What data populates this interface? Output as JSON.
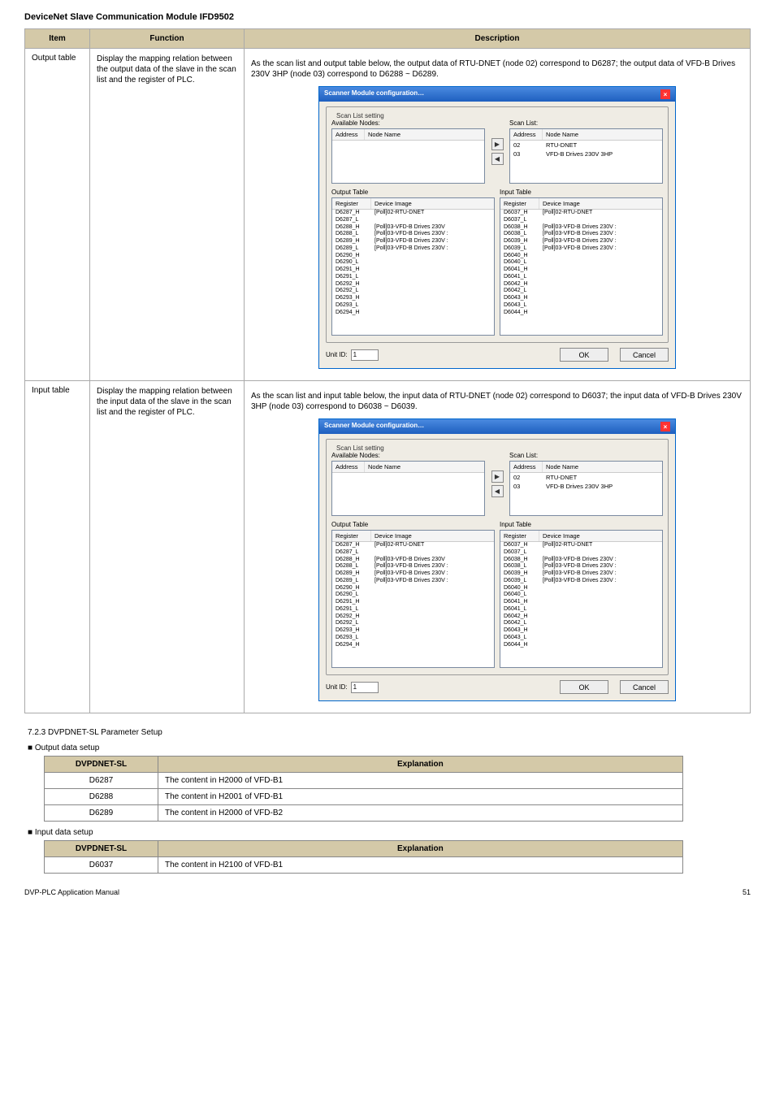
{
  "page_header": "DeviceNet Slave Communication Module IFD9502",
  "doc_title": "DeviceNet Slave Communication Module IFD9502",
  "main_table": {
    "hdr_item": "Item",
    "hdr_func": "Function",
    "hdr_desc": "Description",
    "rows": [
      {
        "item": "Output table",
        "func": "Display the mapping relation between the output data of the slave in the scan list and the register of PLC.",
        "pre": "As the scan list and output table below, the output data of RTU-DNET (node 02) correspond to D6287; the output data of VFD-B Drives 230V 3HP (node 03) correspond to D6288 ~ D6289.",
        "scan": [
          {
            "a": "02",
            "n": "RTU-DNET"
          },
          {
            "a": "03",
            "n": "VFD-B Drives 230V 3HP"
          }
        ],
        "output": [
          {
            "r": "D6287_H",
            "d": "[Poll]02-RTU-DNET"
          },
          {
            "r": "D6287_L",
            "d": ""
          },
          {
            "r": "D6288_H",
            "d": "[Poll]03-VFD-B Drives 230V"
          },
          {
            "r": "D6288_L",
            "d": "[Poll]03-VFD-B Drives 230V :"
          },
          {
            "r": "D6289_H",
            "d": "[Poll]03-VFD-B Drives 230V :"
          },
          {
            "r": "D6289_L",
            "d": "[Poll]03-VFD-B Drives 230V :"
          },
          {
            "r": "D6290_H",
            "d": ""
          },
          {
            "r": "D6290_L",
            "d": ""
          },
          {
            "r": "D6291_H",
            "d": ""
          },
          {
            "r": "D6291_L",
            "d": ""
          },
          {
            "r": "D6292_H",
            "d": ""
          },
          {
            "r": "D6292_L",
            "d": ""
          },
          {
            "r": "D6293_H",
            "d": ""
          },
          {
            "r": "D6293_L",
            "d": ""
          },
          {
            "r": "D6294_H",
            "d": ""
          }
        ],
        "input": [
          {
            "r": "D6037_H",
            "d": "[Poll]02-RTU-DNET"
          },
          {
            "r": "D6037_L",
            "d": ""
          },
          {
            "r": "D6038_H",
            "d": "[Poll]03-VFD-B Drives 230V :"
          },
          {
            "r": "D6038_L",
            "d": "[Poll]03-VFD-B Drives 230V :"
          },
          {
            "r": "D6039_H",
            "d": "[Poll]03-VFD-B Drives 230V :"
          },
          {
            "r": "D6039_L",
            "d": "[Poll]03-VFD-B Drives 230V :"
          },
          {
            "r": "D6040_H",
            "d": ""
          },
          {
            "r": "D6040_L",
            "d": ""
          },
          {
            "r": "D6041_H",
            "d": ""
          },
          {
            "r": "D6041_L",
            "d": ""
          },
          {
            "r": "D6042_H",
            "d": ""
          },
          {
            "r": "D6042_L",
            "d": ""
          },
          {
            "r": "D6043_H",
            "d": ""
          },
          {
            "r": "D6043_L",
            "d": ""
          },
          {
            "r": "D6044_H",
            "d": ""
          }
        ]
      },
      {
        "item": "Input table",
        "func": "Display the mapping relation between the input data of the slave in the scan list and the register of PLC.",
        "pre": "As the scan list and input table below, the input data of RTU-DNET (node 02) correspond to D6037; the input data of VFD-B Drives 230V 3HP (node 03) correspond to D6038 ~ D6039.",
        "scan": [
          {
            "a": "02",
            "n": "RTU-DNET"
          },
          {
            "a": "03",
            "n": "VFD-B Drives 230V 3HP"
          }
        ],
        "output": [
          {
            "r": "D6287_H",
            "d": "[Poll]02-RTU-DNET"
          },
          {
            "r": "D6287_L",
            "d": ""
          },
          {
            "r": "D6288_H",
            "d": "[Poll]03-VFD-B Drives 230V"
          },
          {
            "r": "D6288_L",
            "d": "[Poll]03-VFD-B Drives 230V :"
          },
          {
            "r": "D6289_H",
            "d": "[Poll]03-VFD-B Drives 230V :"
          },
          {
            "r": "D6289_L",
            "d": "[Poll]03-VFD-B Drives 230V :"
          },
          {
            "r": "D6290_H",
            "d": ""
          },
          {
            "r": "D6290_L",
            "d": ""
          },
          {
            "r": "D6291_H",
            "d": ""
          },
          {
            "r": "D6291_L",
            "d": ""
          },
          {
            "r": "D6292_H",
            "d": ""
          },
          {
            "r": "D6292_L",
            "d": ""
          },
          {
            "r": "D6293_H",
            "d": ""
          },
          {
            "r": "D6293_L",
            "d": ""
          },
          {
            "r": "D6294_H",
            "d": ""
          }
        ],
        "input": [
          {
            "r": "D6037_H",
            "d": "[Poll]02-RTU-DNET"
          },
          {
            "r": "D6037_L",
            "d": ""
          },
          {
            "r": "D6038_H",
            "d": "[Poll]03-VFD-B Drives 230V :"
          },
          {
            "r": "D6038_L",
            "d": "[Poll]03-VFD-B Drives 230V :"
          },
          {
            "r": "D6039_H",
            "d": "[Poll]03-VFD-B Drives 230V :"
          },
          {
            "r": "D6039_L",
            "d": "[Poll]03-VFD-B Drives 230V :"
          },
          {
            "r": "D6040_H",
            "d": ""
          },
          {
            "r": "D6040_L",
            "d": ""
          },
          {
            "r": "D6041_H",
            "d": ""
          },
          {
            "r": "D6041_L",
            "d": ""
          },
          {
            "r": "D6042_H",
            "d": ""
          },
          {
            "r": "D6042_L",
            "d": ""
          },
          {
            "r": "D6043_H",
            "d": ""
          },
          {
            "r": "D6043_L",
            "d": ""
          },
          {
            "r": "D6044_H",
            "d": ""
          }
        ]
      }
    ]
  },
  "dlg": {
    "title": "Scanner Module configuration…",
    "legend": "Scan List setting",
    "avail_label": "Available Nodes:",
    "scan_label": "Scan List:",
    "col_addr": "Address",
    "col_name": "Node Name",
    "out_label": "Output Table",
    "in_label": "Input Table",
    "col_reg": "Register",
    "col_dev": "Device Image",
    "unit_id": "Unit ID:",
    "unit_val": "1",
    "ok": "OK",
    "cancel": "Cancel"
  },
  "section_7_2_3": "7.2.3  DVPDNET-SL Parameter Setup",
  "out_lead_bullet": "■",
  "out_lead": "Output data setup",
  "out_tbl": {
    "h1": "DVPDNET-SL",
    "h2": "Explanation",
    "rows": [
      {
        "a": "D6287",
        "b": "The content in H2000 of VFD-B1"
      },
      {
        "a": "D6288",
        "b": "The content in H2001 of VFD-B1"
      },
      {
        "a": "D6289",
        "b": "The content in H2000 of VFD-B2"
      }
    ]
  },
  "in_lead": "Input data setup",
  "in_tbl": {
    "h1": "DVPDNET-SL",
    "h2": "Explanation",
    "rows": [
      {
        "a": "D6037",
        "b": "The content in H2100 of VFD-B1"
      }
    ]
  },
  "footer_left": "DVP-PLC Application Manual",
  "footer_right": "51"
}
